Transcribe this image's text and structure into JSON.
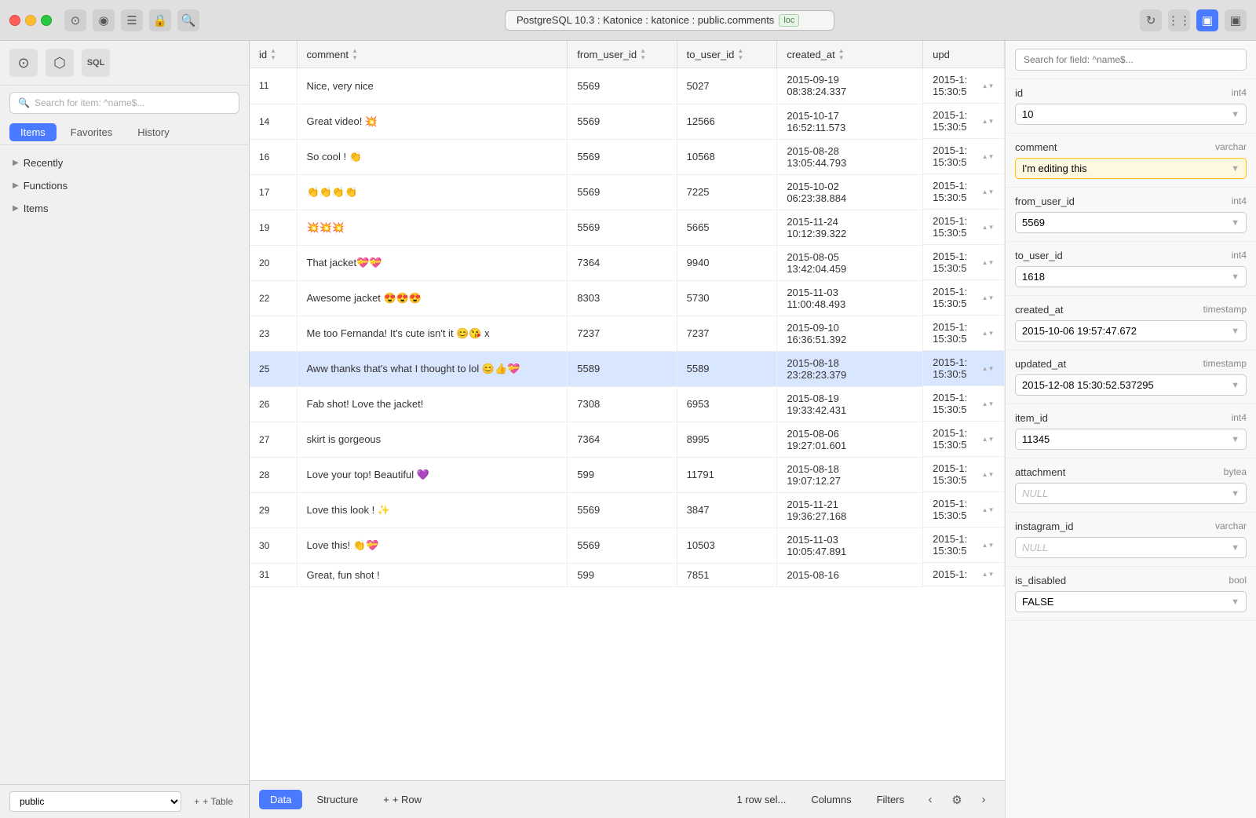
{
  "titlebar": {
    "connection": "PostgreSQL 10.3 : Katonice : katonice : public.comments",
    "loc_badge": "loc",
    "traffic": [
      "close",
      "minimize",
      "maximize"
    ]
  },
  "sidebar": {
    "search_placeholder": "Search for item: ^name$...",
    "tabs": [
      "Items",
      "Favorites",
      "History"
    ],
    "active_tab": "Items",
    "nav_items": [
      {
        "label": "Recently",
        "has_arrow": true
      },
      {
        "label": "Functions",
        "has_arrow": true
      },
      {
        "label": "Items",
        "has_arrow": true
      }
    ],
    "schema": "public",
    "add_table": "+ Table"
  },
  "table": {
    "columns": [
      "id",
      "comment",
      "from_user_id",
      "to_user_id",
      "created_at",
      "upd"
    ],
    "rows": [
      {
        "id": "11",
        "comment": "Nice, very nice",
        "from_user_id": "5569",
        "to_user_id": "5027",
        "created_at": "2015-09-19\n08:38:24.337",
        "upd": "2015-1:\n15:30:5"
      },
      {
        "id": "14",
        "comment": "Great video! 💥",
        "from_user_id": "5569",
        "to_user_id": "12566",
        "created_at": "2015-10-17\n16:52:11.573",
        "upd": "2015-1:\n15:30:5"
      },
      {
        "id": "16",
        "comment": "So cool ! 👏",
        "from_user_id": "5569",
        "to_user_id": "10568",
        "created_at": "2015-08-28\n13:05:44.793",
        "upd": "2015-1:\n15:30:5"
      },
      {
        "id": "17",
        "comment": "👏👏👏👏",
        "from_user_id": "5569",
        "to_user_id": "7225",
        "created_at": "2015-10-02\n06:23:38.884",
        "upd": "2015-1:\n15:30:5"
      },
      {
        "id": "19",
        "comment": "💥💥💥",
        "from_user_id": "5569",
        "to_user_id": "5665",
        "created_at": "2015-11-24\n10:12:39.322",
        "upd": "2015-1:\n15:30:5"
      },
      {
        "id": "20",
        "comment": "That jacket💝💝",
        "from_user_id": "7364",
        "to_user_id": "9940",
        "created_at": "2015-08-05\n13:42:04.459",
        "upd": "2015-1:\n15:30:5"
      },
      {
        "id": "22",
        "comment": "Awesome jacket 😍😍😍",
        "from_user_id": "8303",
        "to_user_id": "5730",
        "created_at": "2015-11-03\n11:00:48.493",
        "upd": "2015-1:\n15:30:5"
      },
      {
        "id": "23",
        "comment": "Me too Fernanda! It's cute isn't it 😊😘 x",
        "from_user_id": "7237",
        "to_user_id": "7237",
        "created_at": "2015-09-10\n16:36:51.392",
        "upd": "2015-1:\n15:30:5"
      },
      {
        "id": "25",
        "comment": "Aww thanks that's what I thought to lol 😊👍💝",
        "from_user_id": "5589",
        "to_user_id": "5589",
        "created_at": "2015-08-18\n23:28:23.379",
        "upd": "2015-1:\n15:30:5",
        "selected": true
      },
      {
        "id": "26",
        "comment": "Fab shot! Love the jacket!",
        "from_user_id": "7308",
        "to_user_id": "6953",
        "created_at": "2015-08-19\n19:33:42.431",
        "upd": "2015-1:\n15:30:5"
      },
      {
        "id": "27",
        "comment": "skirt is gorgeous",
        "from_user_id": "7364",
        "to_user_id": "8995",
        "created_at": "2015-08-06\n19:27:01.601",
        "upd": "2015-1:\n15:30:5"
      },
      {
        "id": "28",
        "comment": "Love your top! Beautiful 💜",
        "from_user_id": "599",
        "to_user_id": "11791",
        "created_at": "2015-08-18\n19:07:12.27",
        "upd": "2015-1:\n15:30:5"
      },
      {
        "id": "29",
        "comment": "Love this look ! ✨",
        "from_user_id": "5569",
        "to_user_id": "3847",
        "created_at": "2015-11-21\n19:36:27.168",
        "upd": "2015-1:\n15:30:5"
      },
      {
        "id": "30",
        "comment": "Love this! 👏💝",
        "from_user_id": "5569",
        "to_user_id": "10503",
        "created_at": "2015-11-03\n10:05:47.891",
        "upd": "2015-1:\n15:30:5"
      },
      {
        "id": "31",
        "comment": "Great, fun shot !",
        "from_user_id": "599",
        "to_user_id": "7851",
        "created_at": "2015-08-16\n",
        "upd": "2015-1:"
      }
    ]
  },
  "bottom_toolbar": {
    "tabs": [
      "Data",
      "Structure"
    ],
    "active_tab": "Data",
    "add_row": "+ Row",
    "row_sel": "1 row sel...",
    "columns": "Columns",
    "filters": "Filters"
  },
  "right_panel": {
    "search_placeholder": "Search for field: ^name$...",
    "fields": [
      {
        "name": "id",
        "type": "int4",
        "value": "10",
        "is_dropdown": true,
        "editing": false
      },
      {
        "name": "comment",
        "type": "varchar",
        "value": "I'm editing this",
        "is_dropdown": true,
        "editing": true
      },
      {
        "name": "from_user_id",
        "type": "int4",
        "value": "5569",
        "is_dropdown": true,
        "editing": false
      },
      {
        "name": "to_user_id",
        "type": "int4",
        "value": "1618",
        "is_dropdown": true,
        "editing": false
      },
      {
        "name": "created_at",
        "type": "timestamp",
        "value": "2015-10-06 19:57:47.672",
        "is_dropdown": true,
        "editing": false
      },
      {
        "name": "updated_at",
        "type": "timestamp",
        "value": "2015-12-08 15:30:52.537295",
        "is_dropdown": true,
        "editing": false
      },
      {
        "name": "item_id",
        "type": "int4",
        "value": "11345",
        "is_dropdown": true,
        "editing": false
      },
      {
        "name": "attachment",
        "type": "bytea",
        "value": "NULL",
        "is_null": true,
        "is_dropdown": true,
        "editing": false
      },
      {
        "name": "instagram_id",
        "type": "varchar",
        "value": "NULL",
        "is_null": true,
        "is_dropdown": true,
        "editing": false
      },
      {
        "name": "is_disabled",
        "type": "bool",
        "value": "FALSE",
        "is_dropdown": true,
        "editing": false
      }
    ]
  }
}
